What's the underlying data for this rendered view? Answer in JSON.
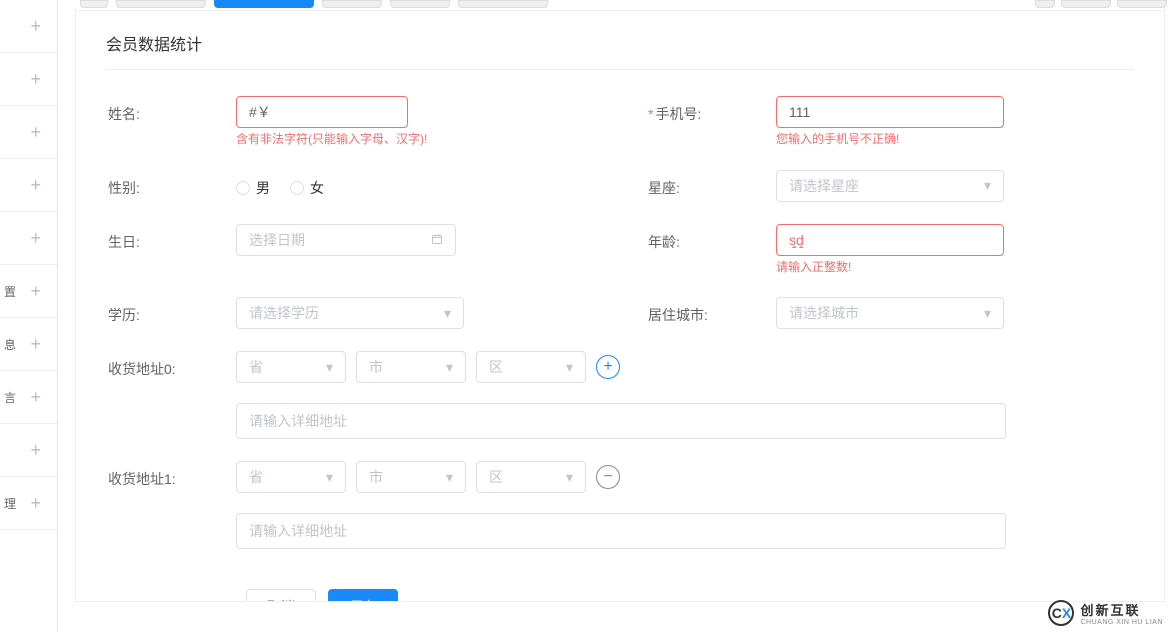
{
  "section_title": "会员数据统计",
  "sidebar_labels": [
    "",
    "",
    "",
    "",
    "",
    "置",
    "息",
    "言",
    "",
    "理"
  ],
  "form": {
    "name": {
      "label": "姓名:",
      "value": "#￥",
      "error": "含有非法字符(只能输入字母、汉字)!"
    },
    "phone": {
      "label": "手机号:",
      "value": "111",
      "error": "您输入的手机号不正确!"
    },
    "gender": {
      "label": "性别:",
      "options": [
        "男",
        "女"
      ]
    },
    "zodiac": {
      "label": "星座:",
      "placeholder": "请选择星座"
    },
    "birthday": {
      "label": "生日:",
      "placeholder": "选择日期"
    },
    "age": {
      "label": "年龄:",
      "value": "sd",
      "error": "请输入正整数!"
    },
    "education": {
      "label": "学历:",
      "placeholder": "请选择学历"
    },
    "city": {
      "label": "居住城市:",
      "placeholder": "请选择城市"
    },
    "addresses": [
      {
        "label": "收货地址0:",
        "province": "省",
        "city": "市",
        "district": "区",
        "detail_placeholder": "请输入详细地址",
        "action": "add"
      },
      {
        "label": "收货地址1:",
        "province": "省",
        "city": "市",
        "district": "区",
        "detail_placeholder": "请输入详细地址",
        "action": "remove"
      }
    ]
  },
  "buttons": {
    "cancel": "取消",
    "save": "保存"
  },
  "brand": {
    "name": "创新互联",
    "sub": "CHUANG XIN HU LIAN"
  }
}
